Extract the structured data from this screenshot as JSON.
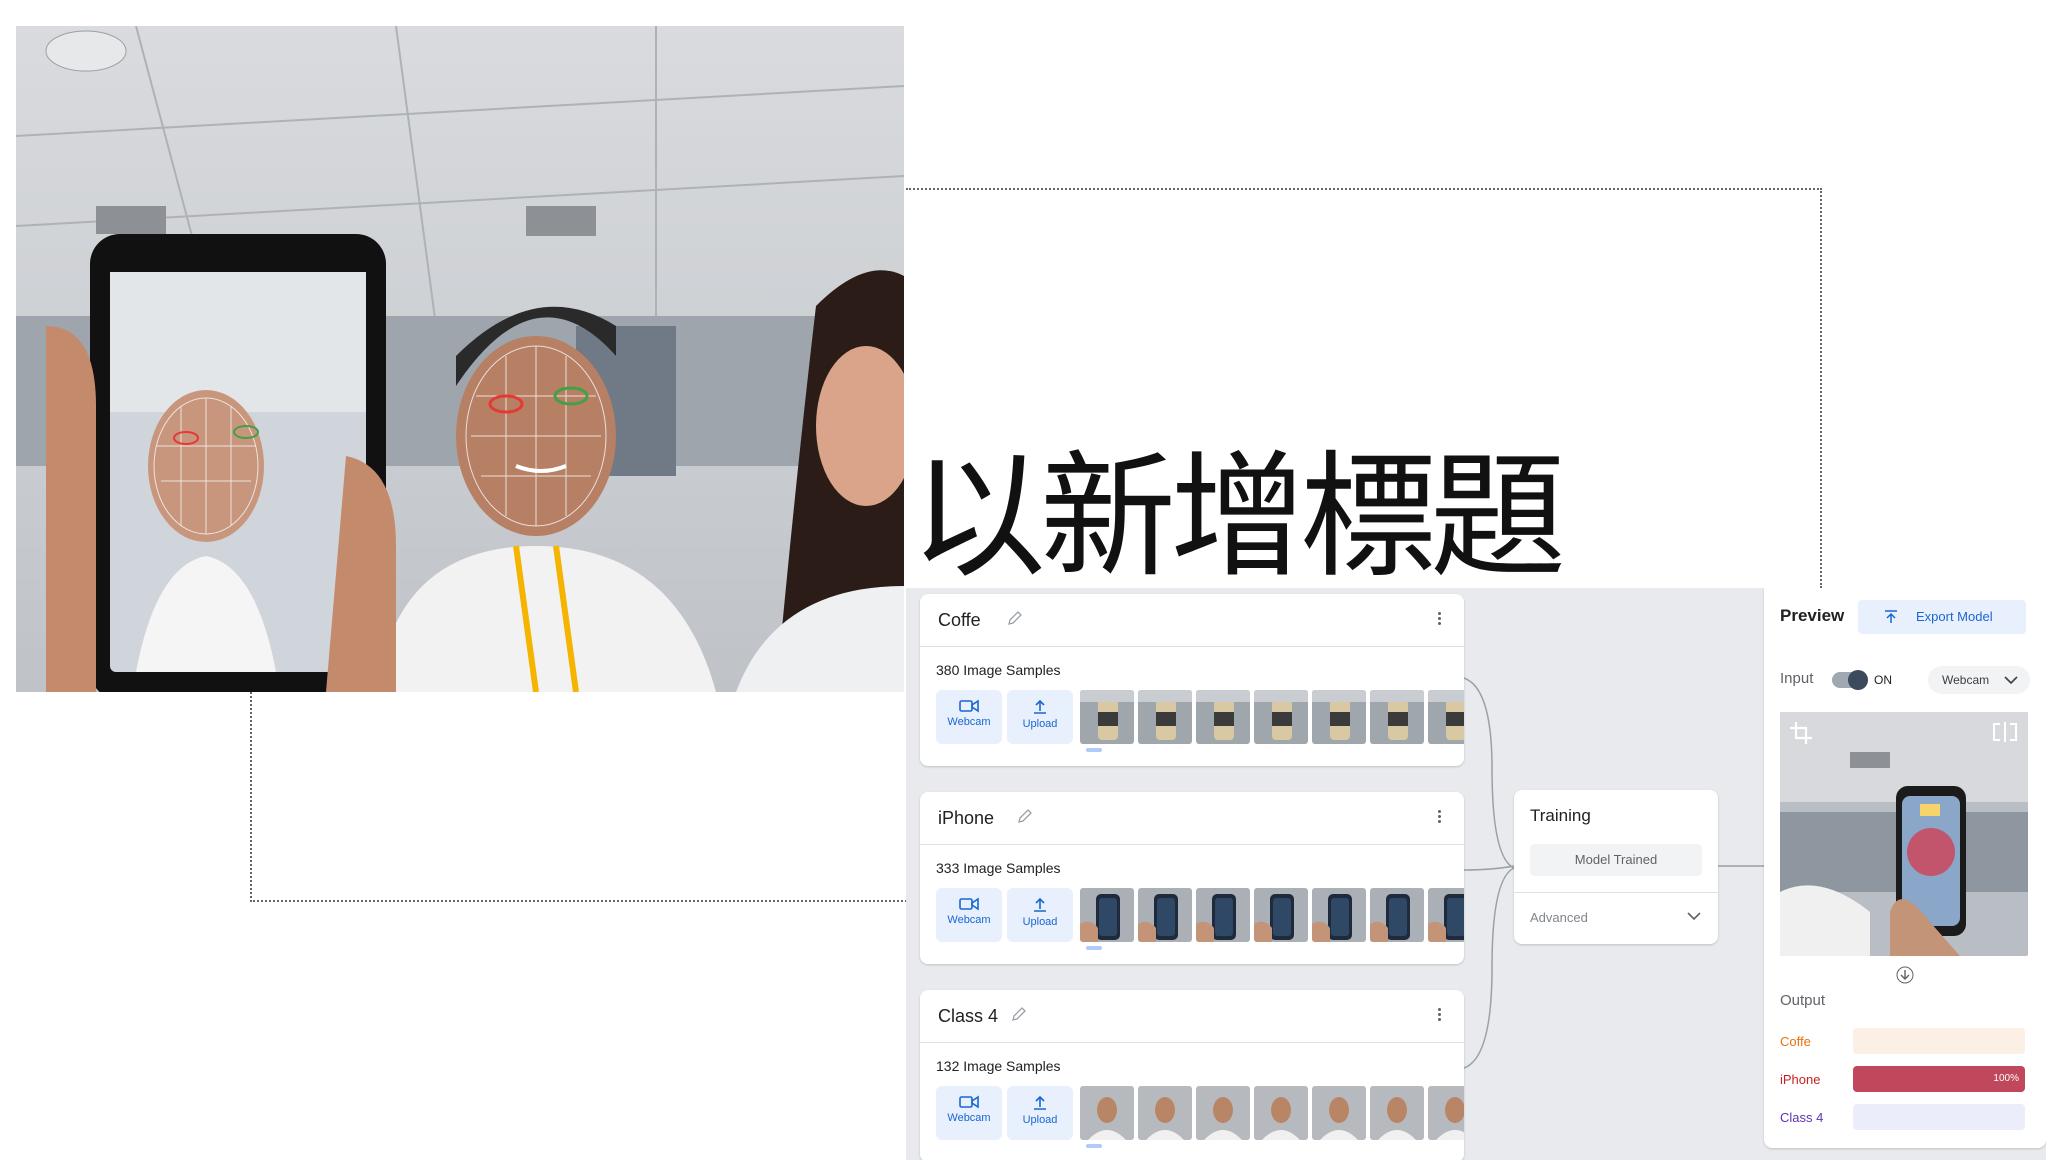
{
  "slide": {
    "title": "以新增標題"
  },
  "photo": {
    "alt": "photo"
  },
  "classes": [
    {
      "name": "Coffe",
      "samples": "380 Image Samples",
      "webcam": "Webcam",
      "upload": "Upload"
    },
    {
      "name": "iPhone",
      "samples": "333 Image Samples",
      "webcam": "Webcam",
      "upload": "Upload"
    },
    {
      "name": "Class 4",
      "samples": "132 Image Samples",
      "webcam": "Webcam",
      "upload": "Upload"
    }
  ],
  "training": {
    "title": "Training",
    "status": "Model Trained",
    "advanced": "Advanced"
  },
  "preview": {
    "title": "Preview",
    "export": "Export Model",
    "input_label": "Input",
    "toggle_state": "ON",
    "source": "Webcam",
    "output_label": "Output",
    "outputs": [
      {
        "label": "Coffe",
        "value": 0,
        "color": "#e8710a",
        "track": "#fcefe3",
        "fill": "#e8710a",
        "pct": ""
      },
      {
        "label": "iPhone",
        "value": 1,
        "color": "#c5221f",
        "track": "#fce8e6",
        "fill": "#c0485c",
        "pct": "100%"
      },
      {
        "label": "Class 4",
        "value": 0,
        "color": "#5e35b1",
        "track": "#ecedfb",
        "fill": "#5e35b1",
        "pct": ""
      }
    ]
  },
  "colors": {
    "accent": "#1967d2",
    "panel": "#e8eaed"
  }
}
